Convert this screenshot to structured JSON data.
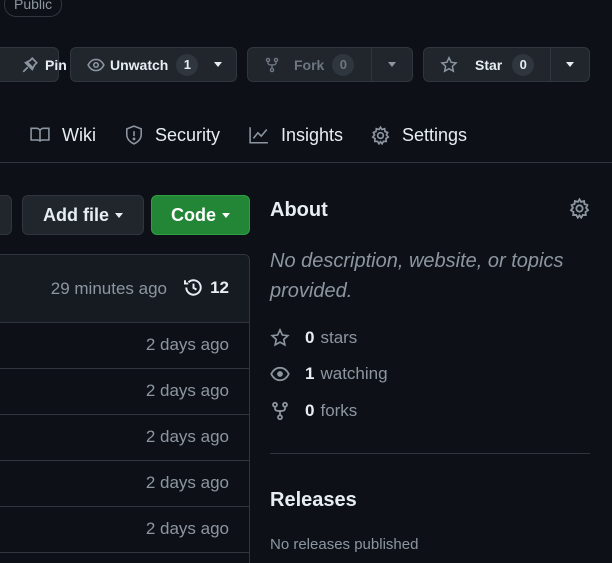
{
  "repo": {
    "visibility_badge": "Public"
  },
  "actions": {
    "pin_label": "Pin",
    "unwatch_label": "Unwatch",
    "unwatch_count": "1",
    "fork_label": "Fork",
    "fork_count": "0",
    "star_label": "Star",
    "star_count": "0"
  },
  "nav": {
    "items": [
      {
        "label": "Wiki",
        "icon": "book-icon"
      },
      {
        "label": "Security",
        "icon": "shield-icon"
      },
      {
        "label": "Insights",
        "icon": "graph-icon"
      },
      {
        "label": "Settings",
        "icon": "gear-icon"
      }
    ]
  },
  "files": {
    "add_file_label": "Add file",
    "code_label": "Code",
    "latest_commit_time": "29 minutes ago",
    "commit_count": "12",
    "rows": [
      {
        "age": "2 days ago"
      },
      {
        "age": "2 days ago"
      },
      {
        "age": "2 days ago"
      },
      {
        "age": "2 days ago"
      },
      {
        "age": "2 days ago"
      }
    ]
  },
  "about": {
    "title": "About",
    "description": "No description, website, or topics provided.",
    "stars_count": "0",
    "stars_label": "stars",
    "watching_count": "1",
    "watching_label": "watching",
    "forks_count": "0",
    "forks_label": "forks"
  },
  "releases": {
    "title": "Releases",
    "empty_text": "No releases published"
  },
  "colors": {
    "background": "#0d1117",
    "border": "#30363d",
    "button_bg": "#21262d",
    "code_green": "#238636",
    "muted_text": "#8d96a0"
  }
}
